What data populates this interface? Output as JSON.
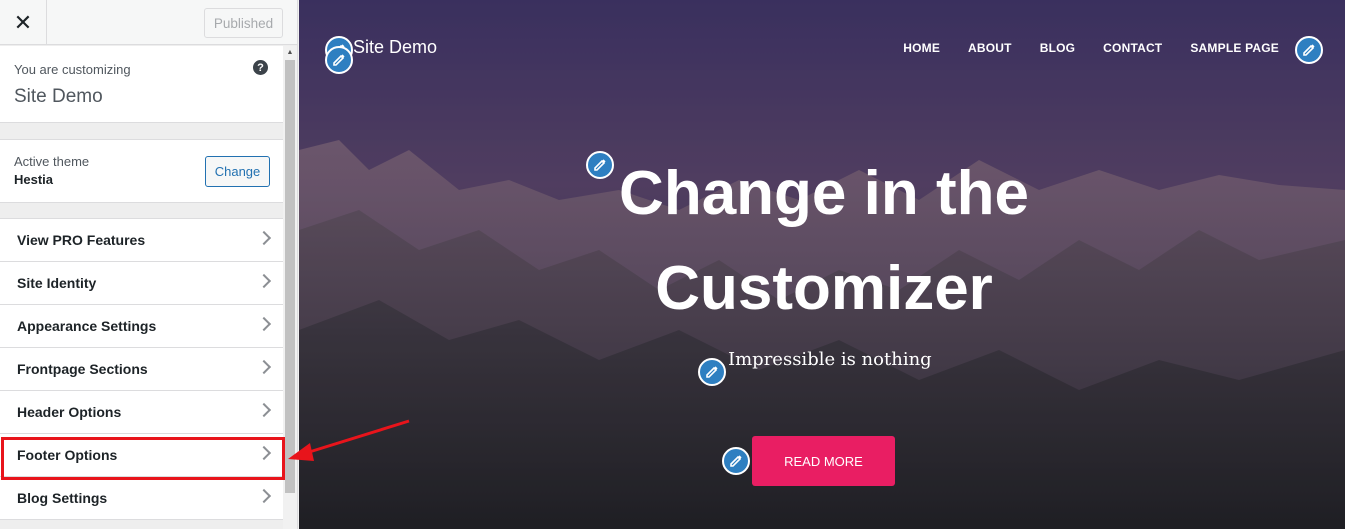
{
  "toolbar": {
    "close_label": "✕",
    "publish_label": "Published"
  },
  "info": {
    "label": "You are customizing",
    "site_name": "Site Demo",
    "help_glyph": "?"
  },
  "theme": {
    "label": "Active theme",
    "name": "Hestia",
    "change_label": "Change"
  },
  "menu": {
    "items": [
      {
        "label": "View PRO Features"
      },
      {
        "label": "Site Identity"
      },
      {
        "label": "Appearance Settings"
      },
      {
        "label": "Frontpage Sections"
      },
      {
        "label": "Header Options"
      },
      {
        "label": "Footer Options"
      },
      {
        "label": "Blog Settings"
      }
    ]
  },
  "preview": {
    "brand": "Site Demo",
    "nav": [
      "HOME",
      "ABOUT",
      "BLOG",
      "CONTACT",
      "SAMPLE PAGE"
    ],
    "hero_title_line1": "Change in the",
    "hero_title_line2": "Customizer",
    "hero_subtitle": "Impressible is nothing",
    "cta_label": "READ MORE"
  },
  "colors": {
    "accent": "#2271b1",
    "cta": "#e91e63",
    "highlight": "#e8141b",
    "edit_pin": "#2e7fc1"
  },
  "icons": [
    "close-icon",
    "help-icon",
    "chevron-right-icon",
    "pencil-icon",
    "arrow-icon"
  ]
}
